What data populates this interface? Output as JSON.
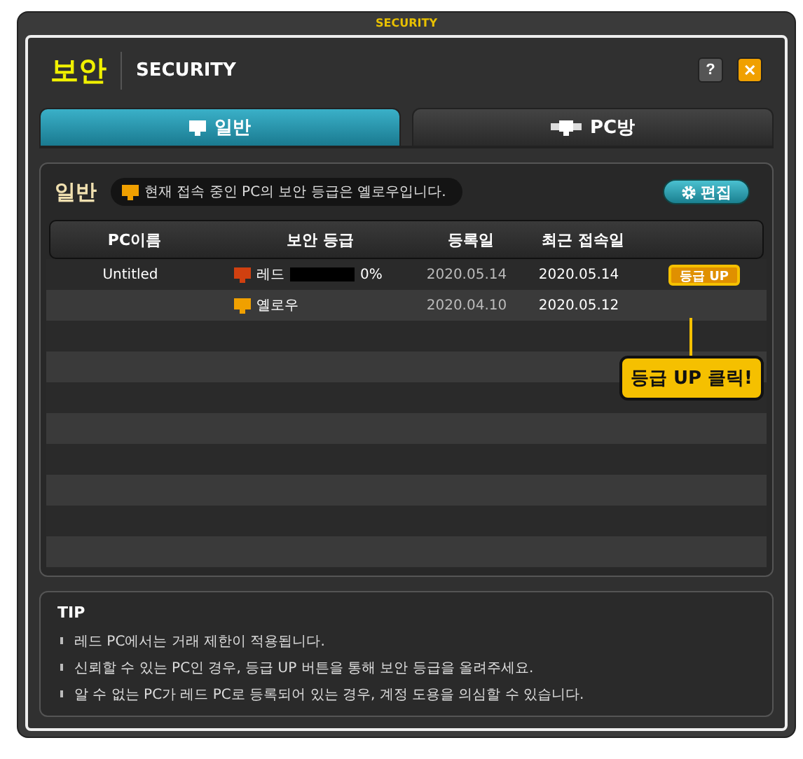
{
  "window": {
    "caption": "SECURITY",
    "title": "보안",
    "subtitle": "SECURITY",
    "help": "?",
    "close": "✕"
  },
  "tabs": [
    {
      "label": "일반",
      "selected": true,
      "kind": "monitor"
    },
    {
      "label": "PC방",
      "selected": false,
      "kind": "multi"
    }
  ],
  "panel": {
    "title": "일반",
    "notice": "현재 접속 중인 PC의 보안 등급은 옐로우입니다.",
    "edit_button": "편집"
  },
  "table": {
    "columns": [
      "PC이름",
      "보안 등급",
      "등록일",
      "최근 접속일"
    ],
    "rows": [
      {
        "name": "Untitled",
        "grade": "레드",
        "color": "#d04010",
        "show_meter": true,
        "level": 0,
        "percent": "0%",
        "registered": "2020.05.14",
        "last_access": "2020.05.14",
        "action": "등급 UP"
      },
      {
        "grade": "옐로우",
        "color": "#f0a000",
        "show_meter": false,
        "registered": "2020.04.10",
        "last_access": "2020.05.12"
      }
    ]
  },
  "callout": "등급 UP 클릭!",
  "tip": {
    "title": "TIP",
    "items": [
      "레드 PC에서는 거래 제한이 적용됩니다.",
      "신뢰할 수 있는 PC인 경우, 등급 UP 버튼을 통해 보안 등급을 올려주세요.",
      "알 수 없는 PC가 레드 PC로 등록되어 있는 경우, 계정 도용을 의심할 수 있습니다."
    ]
  }
}
